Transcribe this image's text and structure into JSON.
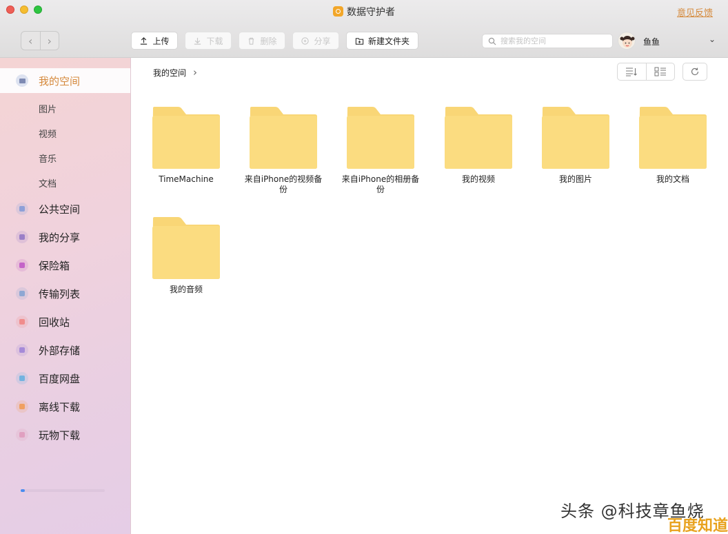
{
  "window": {
    "title": "数据守护者",
    "feedback_link": "意见反馈"
  },
  "toolbar": {
    "upload": "上传",
    "download": "下载",
    "delete": "删除",
    "share": "分享",
    "new_folder": "新建文件夹",
    "search_placeholder": "搜索我的空间",
    "username": "鱼鱼"
  },
  "sidebar": {
    "active": {
      "label": "我的空间",
      "icon": "folder-icon",
      "color": "#7e8ab3"
    },
    "sub_items": [
      "图片",
      "视频",
      "音乐",
      "文档"
    ],
    "items": [
      {
        "label": "公共空间",
        "icon": "plane-icon",
        "color": "#8ea0d8"
      },
      {
        "label": "我的分享",
        "icon": "share-icon",
        "color": "#9b7fc7"
      },
      {
        "label": "保险箱",
        "icon": "safe-icon",
        "color": "#c463c8"
      },
      {
        "label": "传输列表",
        "icon": "transfer-icon",
        "color": "#8ea7d3"
      },
      {
        "label": "回收站",
        "icon": "trash-icon",
        "color": "#f08c8c"
      },
      {
        "label": "外部存储",
        "icon": "storage-icon",
        "color": "#a68ad8"
      },
      {
        "label": "百度网盘",
        "icon": "cloud-icon",
        "color": "#73b3e0"
      },
      {
        "label": "离线下载",
        "icon": "download-icon",
        "color": "#f0a060"
      },
      {
        "label": "玩物下载",
        "icon": "game-icon",
        "color": "#e0a0c0"
      }
    ],
    "storage_used_fraction": 0.05
  },
  "main": {
    "breadcrumb": "我的空间",
    "folders": [
      "TimeMachine",
      "来自iPhone的视频备份",
      "来自iPhone的相册备份",
      "我的视频",
      "我的图片",
      "我的文档",
      "我的音频"
    ]
  },
  "watermark": {
    "line1": "头条 @科技章鱼烧",
    "line2": "百度知道"
  },
  "colors": {
    "folder": "#fbdc80",
    "folder_tab": "#f9d676",
    "accent": "#4a8df0",
    "feedback": "#d58a3c"
  }
}
